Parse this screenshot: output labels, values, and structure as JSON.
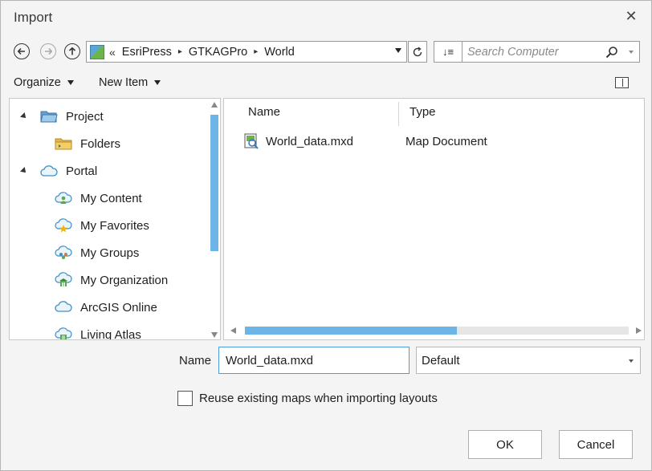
{
  "dialog": {
    "title": "Import",
    "close_glyph": "✕"
  },
  "navigation": {
    "back_icon": "back-arrow-icon",
    "forward_icon": "forward-arrow-icon",
    "up_icon": "up-arrow-icon"
  },
  "address": {
    "prefix": "«",
    "crumbs": [
      "EsriPress",
      "GTKAGPro",
      "World"
    ],
    "separator": "▸"
  },
  "sort_label": "↓≡",
  "search": {
    "placeholder": "Search Computer"
  },
  "toolbar": {
    "organize_label": "Organize",
    "new_item_label": "New Item"
  },
  "tree": {
    "items": [
      {
        "label": "Project",
        "icon": "project-folder-icon",
        "level": 0,
        "expanded": true
      },
      {
        "label": "Folders",
        "icon": "folders-icon",
        "level": 1
      },
      {
        "label": "Portal",
        "icon": "portal-cloud-icon",
        "level": 0,
        "expanded": true
      },
      {
        "label": "My Content",
        "icon": "my-content-icon",
        "level": 1
      },
      {
        "label": "My Favorites",
        "icon": "my-favorites-icon",
        "level": 1
      },
      {
        "label": "My Groups",
        "icon": "my-groups-icon",
        "level": 1
      },
      {
        "label": "My Organization",
        "icon": "my-organization-icon",
        "level": 1
      },
      {
        "label": "ArcGIS Online",
        "icon": "arcgis-online-icon",
        "level": 1
      },
      {
        "label": "Living Atlas",
        "icon": "living-atlas-icon",
        "level": 1
      }
    ]
  },
  "files": {
    "columns": [
      "Name",
      "Type"
    ],
    "rows": [
      {
        "name": "World_data.mxd",
        "type": "Map Document",
        "icon": "map-document-icon"
      }
    ]
  },
  "form": {
    "name_label": "Name",
    "name_value": "World_data.mxd",
    "filter_value": "Default",
    "checkbox_label": "Reuse existing maps when importing layouts",
    "checkbox_checked": false
  },
  "buttons": {
    "ok_label": "OK",
    "cancel_label": "Cancel"
  },
  "colors": {
    "accent": "#4a9fd8",
    "scroll_thumb": "#6cb5e6"
  }
}
